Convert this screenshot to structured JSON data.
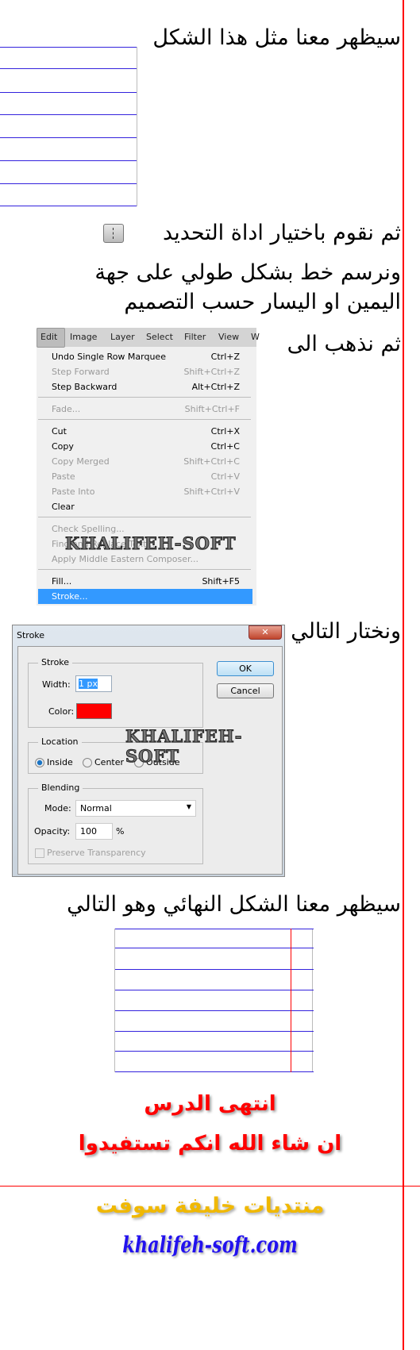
{
  "texts": {
    "line1": "سيظهر معنا مثل هذا الشكل",
    "line2": "ثم نقوم باختيار اداة التحديد",
    "line3": "ونرسم خط بشكل طولي على جهة",
    "line4": "اليمين او اليسار حسب التصميم",
    "line5": "ثم نذهب الى",
    "line6": "ونختار التالي",
    "line7": "سيظهر معنا الشكل النهائي وهو التالي",
    "end1": "انتهى الدرس",
    "end2": "ان شاء الله انكم تستفيدوا",
    "forum": "منتديات خليفة سوفت",
    "site": "khalifeh-soft.com"
  },
  "watermark": "KHALIFEH-SOFT",
  "tool_icon": "single-column-marquee-icon",
  "menu": {
    "bar": [
      "Edit",
      "Image",
      "Layer",
      "Select",
      "Filter",
      "View",
      "W"
    ],
    "items": [
      {
        "label": "Undo Single Row Marquee",
        "shortcut": "Ctrl+Z",
        "enabled": true
      },
      {
        "label": "Step Forward",
        "shortcut": "Shift+Ctrl+Z",
        "enabled": false
      },
      {
        "label": "Step Backward",
        "shortcut": "Alt+Ctrl+Z",
        "enabled": true
      },
      {
        "label": "Fade...",
        "shortcut": "Shift+Ctrl+F",
        "enabled": false
      },
      {
        "label": "Cut",
        "shortcut": "Ctrl+X",
        "enabled": true
      },
      {
        "label": "Copy",
        "shortcut": "Ctrl+C",
        "enabled": true
      },
      {
        "label": "Copy Merged",
        "shortcut": "Shift+Ctrl+C",
        "enabled": false
      },
      {
        "label": "Paste",
        "shortcut": "Ctrl+V",
        "enabled": false
      },
      {
        "label": "Paste Into",
        "shortcut": "Shift+Ctrl+V",
        "enabled": false
      },
      {
        "label": "Clear",
        "shortcut": "",
        "enabled": true
      },
      {
        "label": "Check Spelling...",
        "shortcut": "",
        "enabled": false
      },
      {
        "label": "Find and Replace Text...",
        "shortcut": "",
        "enabled": false
      },
      {
        "label": "Apply Middle Eastern Composer...",
        "shortcut": "",
        "enabled": false
      },
      {
        "label": "Fill...",
        "shortcut": "Shift+F5",
        "enabled": true
      },
      {
        "label": "Stroke...",
        "shortcut": "",
        "enabled": true,
        "highlighted": true
      }
    ]
  },
  "dialog": {
    "title": "Stroke",
    "stroke_group": "Stroke",
    "width_label": "Width:",
    "width_value": "1 px",
    "color_label": "Color:",
    "color_value": "#ff0000",
    "location_group": "Location",
    "location_options": [
      "Inside",
      "Center",
      "Outside"
    ],
    "location_selected": "Inside",
    "blending_group": "Blending",
    "mode_label": "Mode:",
    "mode_value": "Normal",
    "opacity_label": "Opacity:",
    "opacity_value": "100",
    "opacity_unit": "%",
    "preserve_label": "Preserve Transparency",
    "preserve_checked": false,
    "ok": "OK",
    "cancel": "Cancel"
  },
  "colors": {
    "lines": "#3322dd",
    "guide": "#ff0000",
    "end_text": "#ff0000",
    "forum": "#f0b800",
    "site": "#2211ee",
    "highlight": "#3399ff"
  }
}
